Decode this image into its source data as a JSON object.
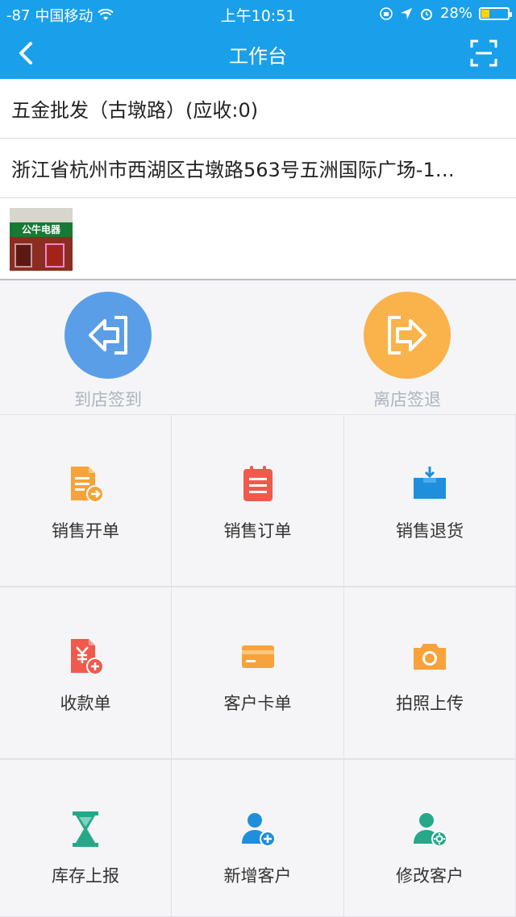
{
  "status": {
    "signal": "-87",
    "carrier": "中国移动",
    "time": "上午10:51",
    "battery": "28%",
    "battery_level": 0.28,
    "colors": {
      "bar": "#1aa0ea",
      "battery_fill": "#ffd400"
    }
  },
  "nav": {
    "title": "工作台",
    "back_icon": "chevron-left-icon",
    "scan_icon": "scan-icon"
  },
  "customer": {
    "name": "五金批发（古墩路）(应收:0)",
    "address": "浙江省杭州市西湖区古墩路563号五洲国际广场-1…",
    "photo_sign": "公牛电器"
  },
  "checkin": {
    "arrive_label": "到店签到",
    "leave_label": "离店签退",
    "colors": {
      "arrive": "#5b9ee8",
      "leave": "#fab24a"
    }
  },
  "grid": [
    {
      "label": "销售开单",
      "icon": "sales-bill-icon",
      "color": "#f7a23a"
    },
    {
      "label": "销售订单",
      "icon": "sales-order-icon",
      "color": "#ef5a4c"
    },
    {
      "label": "销售退货",
      "icon": "sales-return-icon",
      "color": "#1f8fdc"
    },
    {
      "label": "收款单",
      "icon": "receipt-icon",
      "color": "#ef5a4c"
    },
    {
      "label": "客户卡单",
      "icon": "card-icon",
      "color": "#f7a23a"
    },
    {
      "label": "拍照上传",
      "icon": "camera-icon",
      "color": "#f7a23a"
    },
    {
      "label": "库存上报",
      "icon": "hourglass-icon",
      "color": "#26a889"
    },
    {
      "label": "新增客户",
      "icon": "add-user-icon",
      "color": "#1f8fdc"
    },
    {
      "label": "修改客户",
      "icon": "edit-user-icon",
      "color": "#26a889"
    }
  ]
}
